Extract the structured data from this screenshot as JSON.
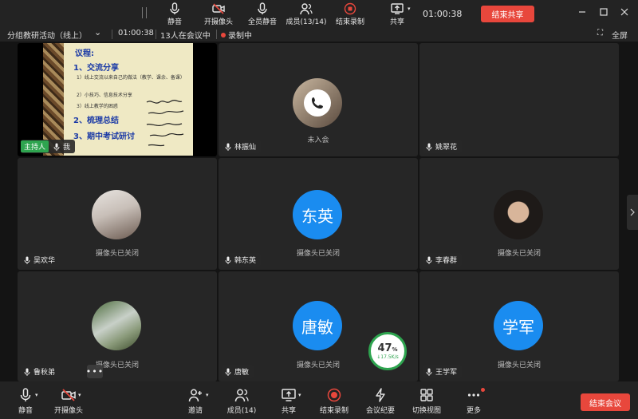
{
  "topbar": {
    "mute": "静音",
    "camera": "开摄像头",
    "mute_all": "全员静音",
    "members": "成员(13/14)",
    "end_record": "结束录制",
    "share": "共享",
    "timer": "01:00:38",
    "end_share": "结束共享"
  },
  "infobar": {
    "meeting_name": "分组教研活动（线上）",
    "duration": "01:00:38",
    "participants": "13人在会议中",
    "recording": "录制中",
    "fullscreen": "全屏"
  },
  "slide": {
    "title": "议程:",
    "item1": "1、交流分享",
    "sub1": "1）线上交流以来自己的做法（教学、课余、备课）",
    "sub2": "2）小技巧、信息技术分享",
    "sub3": "3）线上教学的困惑",
    "item2": "2、梳理总结",
    "item3": "3、期中考试研讨"
  },
  "tiles": [
    {
      "name": "我",
      "host": "主持人"
    },
    {
      "name": "林振仙",
      "status": "未入会"
    },
    {
      "name": "姚翠花"
    },
    {
      "name": "吴欢华",
      "status": "摄像头已关闭"
    },
    {
      "name": "韩东英",
      "status": "摄像头已关闭",
      "avatar_text": "东英"
    },
    {
      "name": "李春群",
      "status": "摄像头已关闭"
    },
    {
      "name": "鲁秋弟",
      "status": "摄像头已关闭",
      "more": "•••"
    },
    {
      "name": "唐敏",
      "status": "摄像头已关闭",
      "avatar_text": "唐敏"
    },
    {
      "name": "王学军",
      "status": "摄像头已关闭",
      "avatar_text": "学军"
    }
  ],
  "network": {
    "percent": "47",
    "percent_unit": "%",
    "rate": "↓17.5K/s"
  },
  "bottombar": {
    "mute": "静音",
    "camera": "开摄像头",
    "invite": "邀请",
    "members": "成员(14)",
    "share": "共享",
    "end_record": "结束录制",
    "summary": "会议纪要",
    "switch_view": "切换视图",
    "more": "更多",
    "end_meeting": "结束会议"
  },
  "colors": {
    "accent_red": "#e8473c",
    "avatar_blue": "#1a8cf0",
    "host_green": "#2ea44f"
  }
}
